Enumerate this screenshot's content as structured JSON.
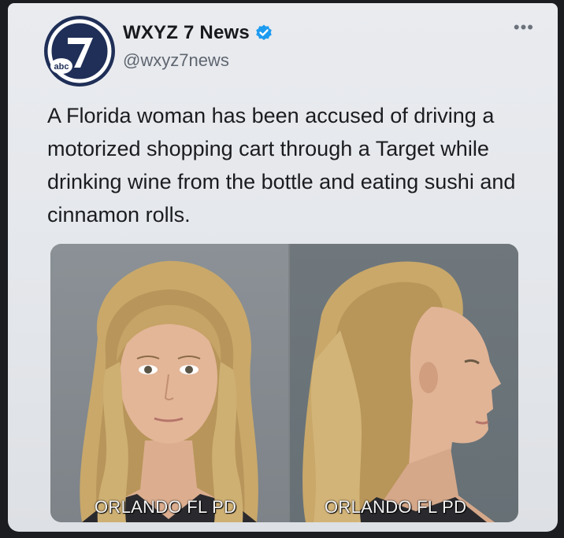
{
  "tweet": {
    "display_name": "WXYZ 7 News",
    "handle": "@wxyz7news",
    "text": "A Florida woman has been accused of driving a motorized shopping cart through a Target while drinking wine from the bottle and eating sushi and cinnamon rolls.",
    "more_icon": "more-dots-icon",
    "verified_icon": "verified-badge-icon",
    "avatar": {
      "logo_text": "abc",
      "logo_number": "7",
      "color": "#1f2f57"
    }
  },
  "media": {
    "photos": [
      {
        "caption": "ORLANDO FL PD",
        "view": "front"
      },
      {
        "caption": "ORLANDO FL PD",
        "view": "profile"
      }
    ]
  },
  "colors": {
    "verified": "#1d9bf0",
    "background": "#e9ebef",
    "text": "#1a1c1f"
  }
}
